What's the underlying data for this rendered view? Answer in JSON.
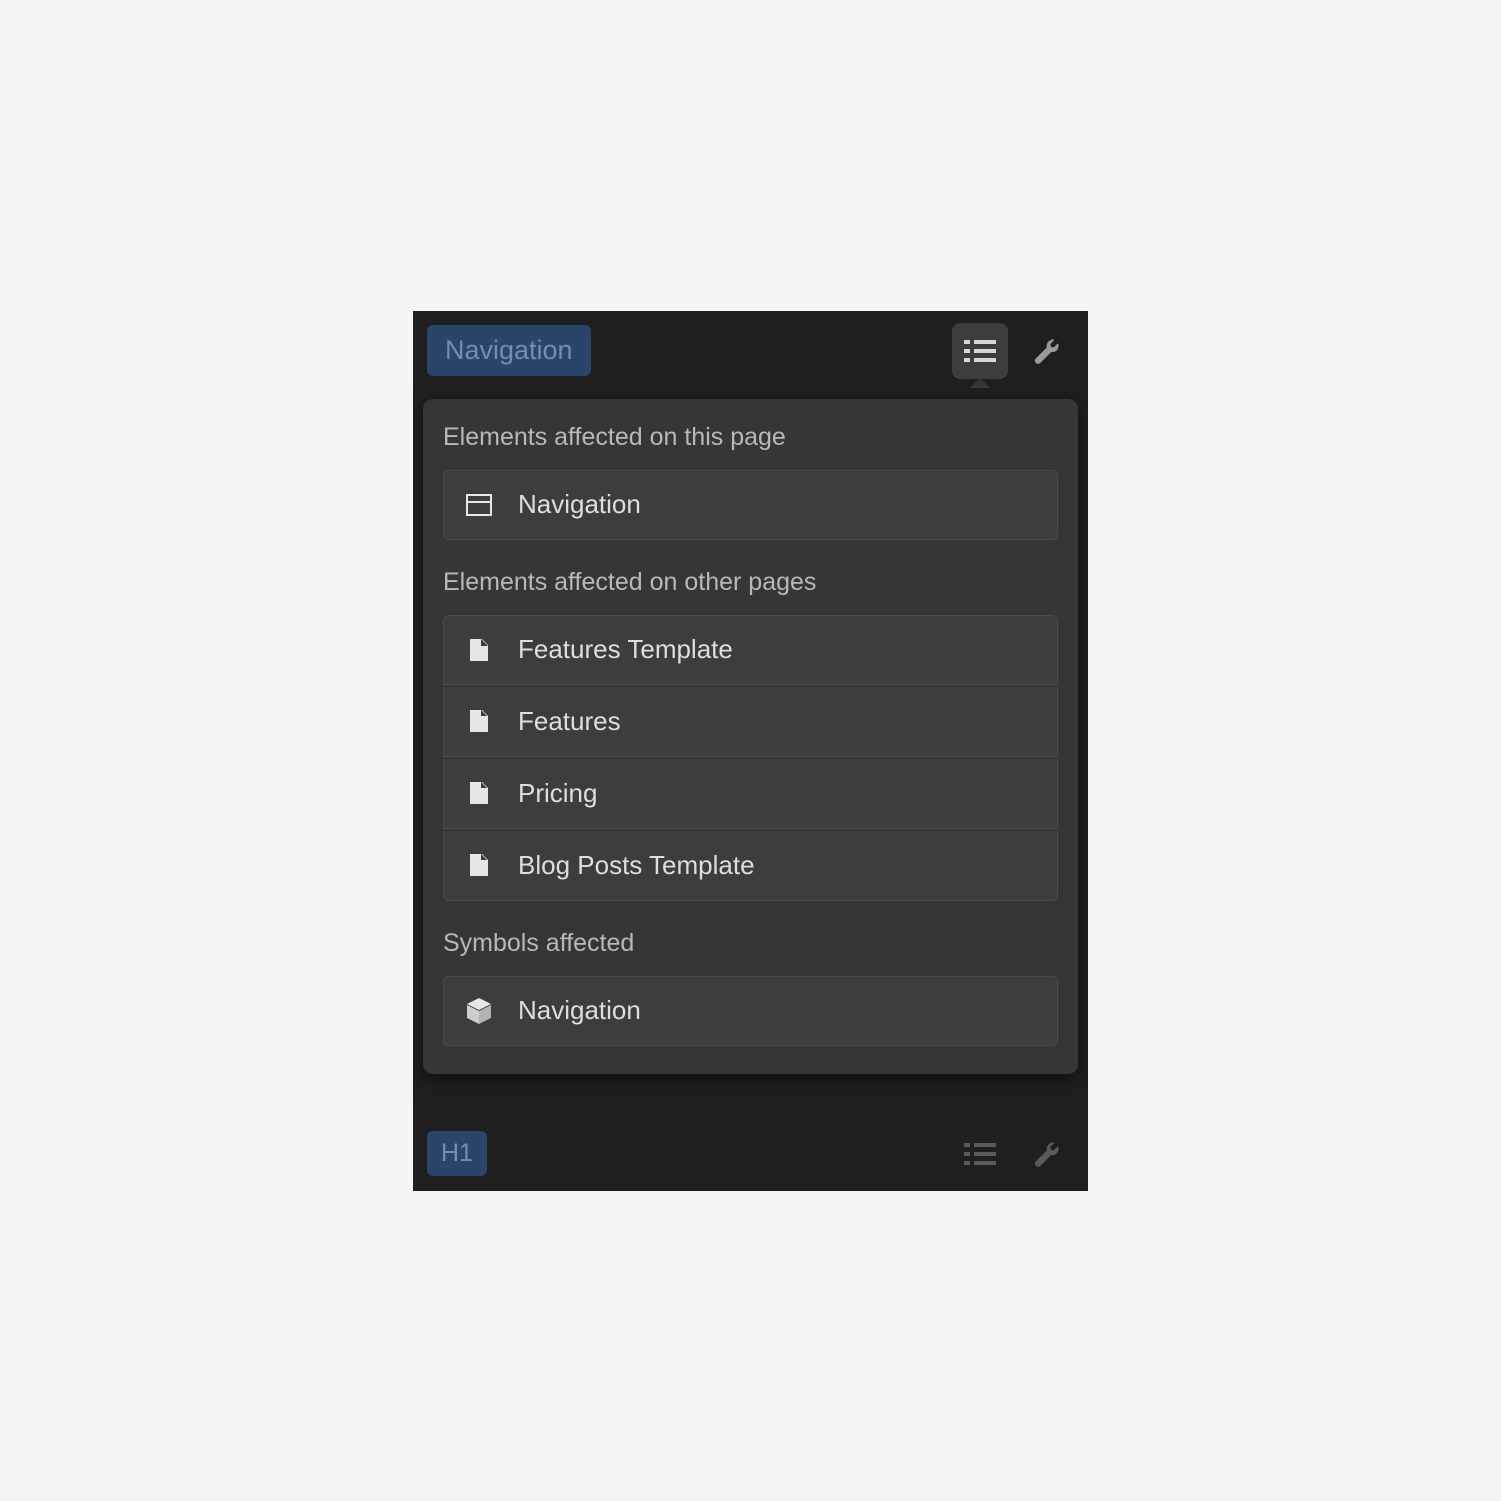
{
  "topbar": {
    "class_name": "Navigation"
  },
  "popover": {
    "section_this_page": "Elements affected on this page",
    "this_page_items": [
      {
        "label": "Navigation"
      }
    ],
    "section_other_pages": "Elements affected on other pages",
    "other_pages_items": [
      {
        "label": "Features Template"
      },
      {
        "label": "Features"
      },
      {
        "label": "Pricing"
      },
      {
        "label": "Blog Posts Template"
      }
    ],
    "section_symbols": "Symbols affected",
    "symbols_items": [
      {
        "label": "Navigation"
      }
    ]
  },
  "bottombar": {
    "tag": "H1"
  }
}
